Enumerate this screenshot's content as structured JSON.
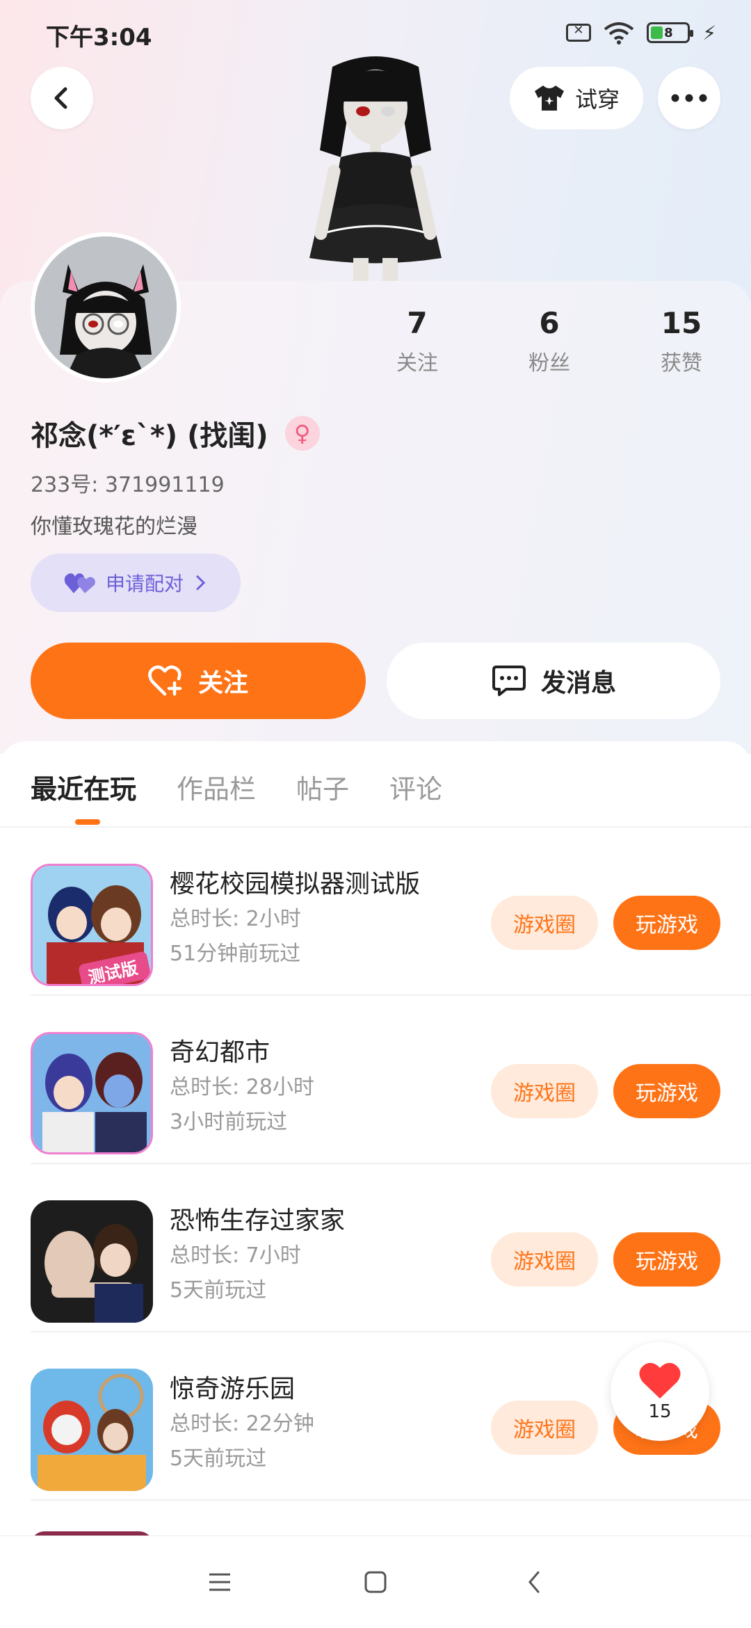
{
  "status_bar": {
    "time": "下午3:04",
    "battery": "8"
  },
  "header": {
    "tryon_label": "试穿"
  },
  "profile": {
    "nickname": "祁念(*′ε`*) (找闺)",
    "gender_symbol": "♀",
    "uid": "233号: 371991119",
    "bio": "你懂玫瑰花的烂漫",
    "pair_label": "申请配对",
    "stats": [
      {
        "value": "7",
        "label": "关注"
      },
      {
        "value": "6",
        "label": "粉丝"
      },
      {
        "value": "15",
        "label": "获赞"
      }
    ]
  },
  "actions": {
    "follow_label": "关注",
    "message_label": "发消息"
  },
  "tabs": [
    {
      "label": "最近在玩"
    },
    {
      "label": "作品栏"
    },
    {
      "label": "帖子"
    },
    {
      "label": "评论"
    }
  ],
  "games": [
    {
      "title": "樱花校园模拟器测试版",
      "duration": "总时长: 2小时",
      "last_played": "51分钟前玩过",
      "circle_label": "游戏圈",
      "play_label": "玩游戏"
    },
    {
      "title": "奇幻都市",
      "duration": "总时长: 28小时",
      "last_played": "3小时前玩过",
      "circle_label": "游戏圈",
      "play_label": "玩游戏"
    },
    {
      "title": "恐怖生存过家家",
      "duration": "总时长: 7小时",
      "last_played": "5天前玩过",
      "circle_label": "游戏圈",
      "play_label": "玩游戏"
    },
    {
      "title": "惊奇游乐园",
      "duration": "总时长: 22分钟",
      "last_played": "5天前玩过",
      "circle_label": "游戏圈",
      "play_label": "玩游戏"
    }
  ],
  "game_icon_badge": "测试版",
  "like_float": {
    "count": "15"
  },
  "colors": {
    "accent": "#ff7317",
    "pair_purple": "#6d5fd8",
    "gender_pink": "#f05a7e"
  }
}
